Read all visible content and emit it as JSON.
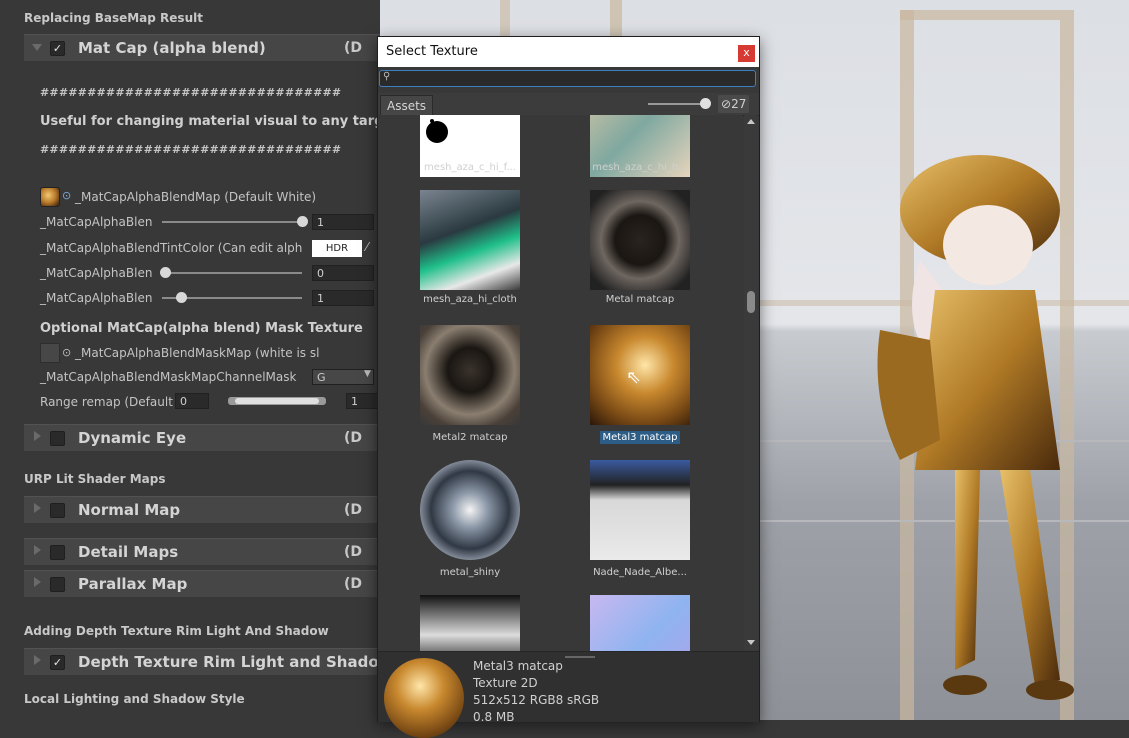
{
  "inspector": {
    "section_replacing": "Replacing BaseMap Result",
    "matcap_foldout": {
      "label": "Mat Cap (alpha blend)",
      "suffix": "(D",
      "checked": "✓"
    },
    "hash_line": "################################",
    "useful_line": "Useful for changing material visual to any target m",
    "map_label": "_MatCapAlphaBlendMap (Default White)",
    "prop1_label": "_MatCapAlphaBlen",
    "prop1_value": "1",
    "tint_label": "_MatCapAlphaBlendTintColor (Can edit alph",
    "hdr_label": "HDR",
    "prop2_label": "_MatCapAlphaBlen",
    "prop2_value": "0",
    "prop3_label": "_MatCapAlphaBlen",
    "prop3_value": "1",
    "mask_title": "Optional MatCap(alpha blend) Mask Texture",
    "mask_map_label": "_MatCapAlphaBlendMaskMap (white is sl",
    "channel_label": "_MatCapAlphaBlendMaskMapChannelMask",
    "channel_value": "G",
    "remap_label": "Range remap (Default",
    "remap_min": "0",
    "remap_max": "1",
    "dynamic_eye": {
      "label": "Dynamic Eye",
      "suffix": "(D"
    },
    "section_urp": "URP Lit Shader Maps",
    "normal_map": {
      "label": "Normal Map",
      "suffix": "(D"
    },
    "detail_maps": {
      "label": "Detail Maps",
      "suffix": "(D"
    },
    "parallax_map": {
      "label": "Parallax Map",
      "suffix": "(D"
    },
    "section_depth": "Adding Depth Texture Rim Light And Shadow",
    "depth_foldout": {
      "label": "Depth Texture Rim Light and Shadow",
      "checked": "✓"
    },
    "section_local": "Local Lighting and Shadow Style"
  },
  "dialog": {
    "title": "Select Texture",
    "close": "x",
    "search_icon": "search-icon",
    "search_placeholder": "",
    "tab_assets": "Assets",
    "visible_count": "27",
    "grid": [
      {
        "name": "mesh_aza_c_hi_f...",
        "kind": "mask-white"
      },
      {
        "name": "mesh_aza_c_hi_h...",
        "kind": "hair"
      },
      {
        "name": "mesh_aza_hi_cloth",
        "kind": "cloth"
      },
      {
        "name": "Metal matcap",
        "kind": "metal-dark"
      },
      {
        "name": "Metal2 matcap",
        "kind": "metal2"
      },
      {
        "name": "Metal3 matcap",
        "kind": "metal3",
        "selected": true
      },
      {
        "name": "metal_shiny",
        "kind": "shiny"
      },
      {
        "name": "Nade_Nade_Albe...",
        "kind": "albedo"
      },
      {
        "name": "",
        "kind": "mask-dark"
      },
      {
        "name": "",
        "kind": "normal"
      }
    ],
    "preview": {
      "name": "Metal3 matcap",
      "type": "Texture 2D",
      "format": "512x512  RGB8 sRGB",
      "size": "0.8 MB"
    }
  },
  "colors": {
    "accent": "#2c5d87",
    "close": "#d63a32",
    "panel": "#383838"
  }
}
